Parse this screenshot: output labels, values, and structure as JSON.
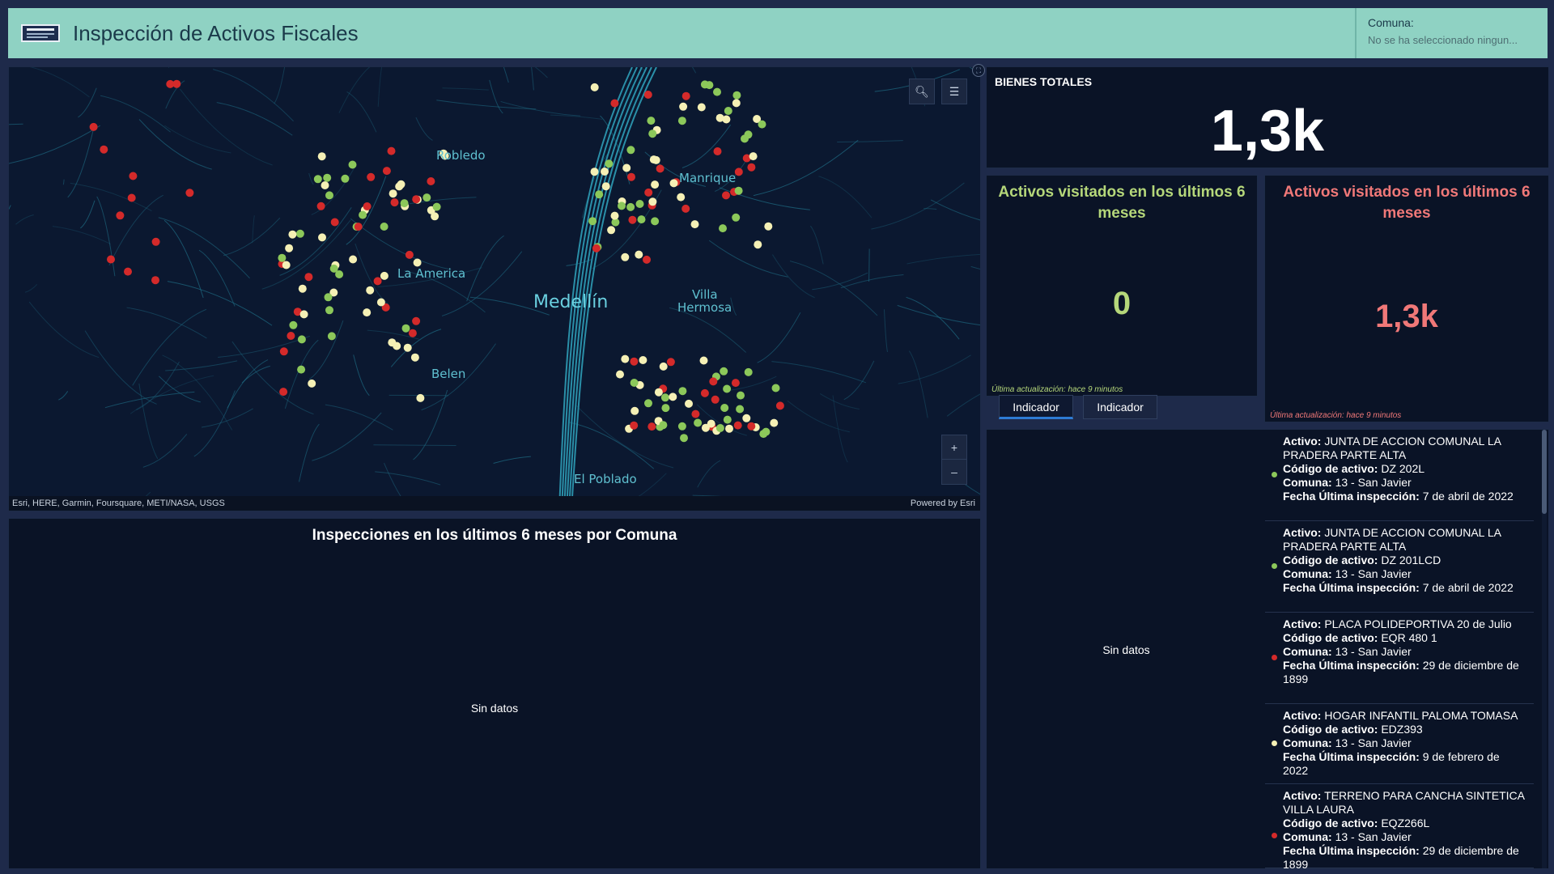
{
  "header": {
    "title": "Inspección de Activos Fiscales",
    "filter_label": "Comuna:",
    "filter_value": "No se ha seleccionado ningun..."
  },
  "map": {
    "labels": {
      "robledo": "Robledo",
      "manrique": "Manrique",
      "la_america": "La America",
      "medellin": "Medellín",
      "villa_hermosa_1": "Villa",
      "villa_hermosa_2": "Hermosa",
      "belen": "Belen",
      "el_poblado": "El Poblado"
    },
    "attribution_left": "Esri, HERE, Garmin, Foursquare, METI/NASA, USGS",
    "attribution_right": "Powered by Esri",
    "zoom_in": "+",
    "zoom_out": "–",
    "colors": {
      "red": "#d42a2a",
      "green": "#8cc85a",
      "yellow": "#f5f0b5",
      "roads": "#1f6e86"
    }
  },
  "chart_panel": {
    "title": "Inspecciones en los últimos 6 meses por Comuna",
    "empty_text": "Sin datos"
  },
  "totals": {
    "label": "BIENES TOTALES",
    "value": "1,3k"
  },
  "indicator_green": {
    "title": "Activos visitados en los últimos 6 meses",
    "value": "0",
    "updated": "Última actualización: hace 9 minutos",
    "color": "#b5d77a"
  },
  "indicator_red": {
    "title": "Activos visitados en los últimos 6 meses",
    "value": "1,3k",
    "updated": "Última actualización: hace 9 minutos",
    "color": "#f07878"
  },
  "tabs": [
    "Indicador",
    "Indicador"
  ],
  "list_panel": {
    "empty_text": "Sin datos",
    "labels": {
      "activo": "Activo:",
      "codigo": "Código de activo:",
      "comuna": "Comuna:",
      "fecha": "Fecha Última inspección:"
    },
    "items": [
      {
        "activo": "JUNTA DE ACCION COMUNAL LA PRADERA PARTE ALTA",
        "codigo": "DZ 202L",
        "comuna": "13 - San Javier",
        "fecha": "7 de abril de 2022",
        "dot": "#8cc85a"
      },
      {
        "activo": "JUNTA DE ACCION COMUNAL LA PRADERA PARTE ALTA",
        "codigo": "DZ 201LCD",
        "comuna": "13 - San Javier",
        "fecha": "7 de abril de 2022",
        "dot": "#8cc85a"
      },
      {
        "activo": "PLACA POLIDEPORTIVA 20 de Julio",
        "codigo": "EQR 480 1",
        "comuna": "13 - San Javier",
        "fecha": "29 de diciembre de 1899",
        "dot": "#d42a2a"
      },
      {
        "activo": "HOGAR INFANTIL PALOMA TOMASA",
        "codigo": "EDZ393",
        "comuna": "13 - San Javier",
        "fecha": "9 de febrero de 2022",
        "dot": "#f5f0b5"
      },
      {
        "activo": "TERRENO PARA CANCHA SINTETICA VILLA LAURA",
        "codigo": "EQZ266L",
        "comuna": "13 - San Javier",
        "fecha": "29 de diciembre de 1899",
        "dot": "#d42a2a"
      }
    ]
  }
}
